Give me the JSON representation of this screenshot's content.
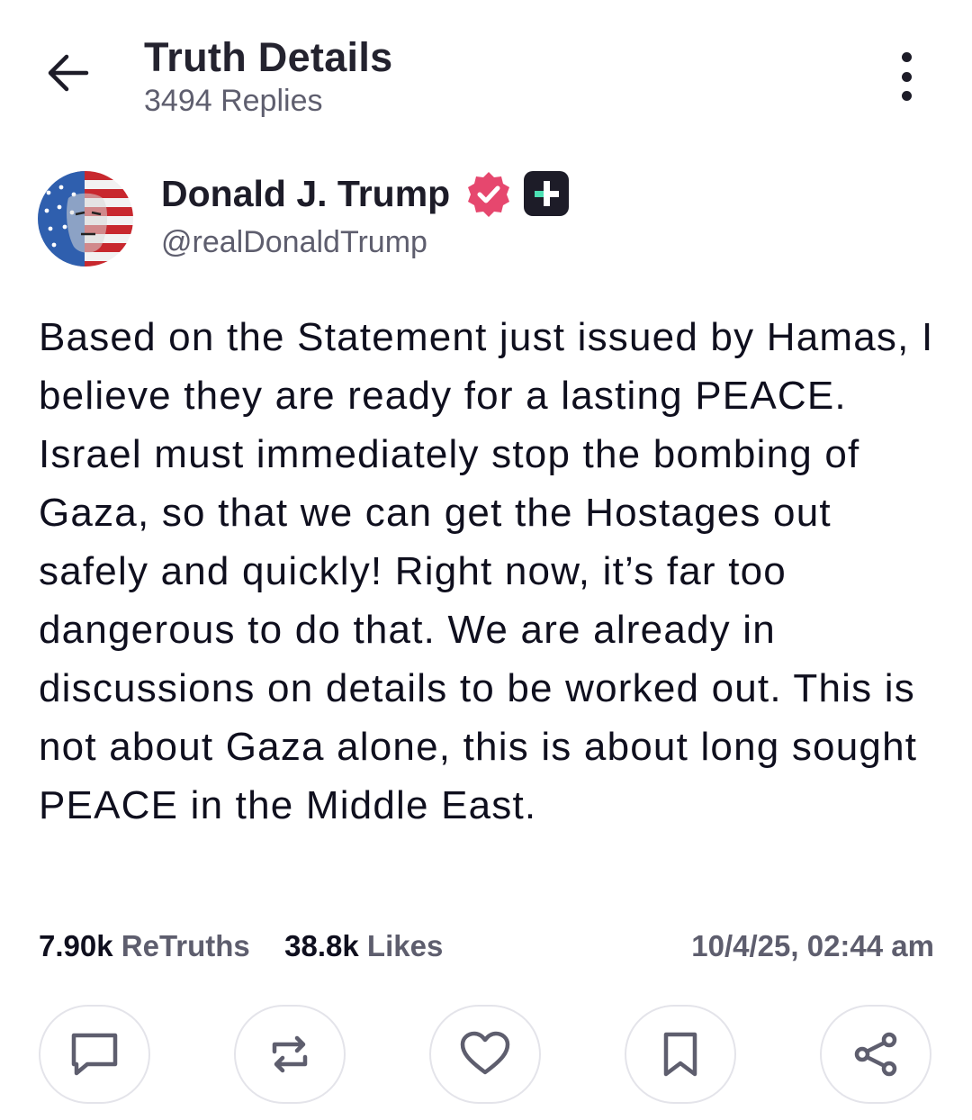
{
  "header": {
    "title": "Truth Details",
    "replies": "3494 Replies",
    "back_icon": "arrow-left-icon",
    "menu_icon": "more-vertical-icon"
  },
  "post": {
    "author_name": "Donald J. Trump",
    "handle": "@realDonaldTrump",
    "verified_icon": "verified-badge-icon",
    "plus_icon": "plus-badge-icon",
    "text": "Based on the Statement just issued by Hamas, I believe they are ready for a lasting PEACE. Israel must immediately stop the bombing of Gaza, so that we can get the Hostages out safely and quickly! Right now, it’s far too dangerous to do that. We are already in discussions on details to be worked out. This is not about Gaza alone, this is about long sought PEACE in the Middle East.",
    "retruths_count": "7.90k",
    "retruths_label": "ReTruths",
    "likes_count": "38.8k",
    "likes_label": "Likes",
    "timestamp": "10/4/25, 02:44 am"
  },
  "actions": [
    "reply-icon",
    "retruth-icon",
    "like-icon",
    "bookmark-icon",
    "share-icon"
  ],
  "colors": {
    "text_primary": "#0f0f1e",
    "text_secondary": "#5e5e6e",
    "verified": "#e6476e",
    "plus_badge": "#1d1c28",
    "plus_accent": "#4ce0b3",
    "border": "#e4e4ea"
  }
}
